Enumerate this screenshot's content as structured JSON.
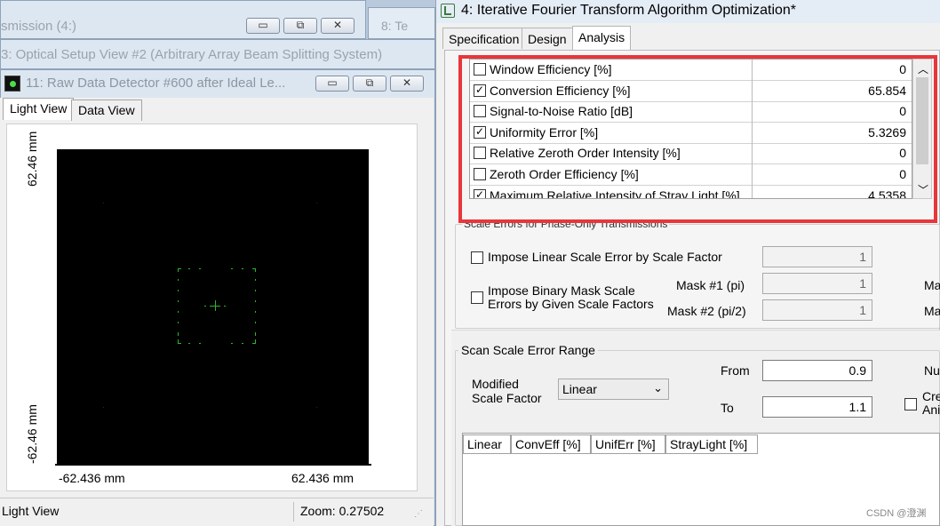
{
  "background_windows": {
    "win1_title": "smission (4:)",
    "win1_tab": "8: Te",
    "win2_title": "3: Optical Setup View #2 (Arbitrary Array Beam Splitting System)"
  },
  "viewer": {
    "title": "11: Raw Data Detector #600 after Ideal Le...",
    "tabs": [
      "Light View",
      "Data View"
    ],
    "y_top_label": "62.46 mm",
    "y_bottom_label": "-62.46 mm",
    "x_left_label": "-62.436 mm",
    "x_right_label": "62.436 mm",
    "status_left": "Light View",
    "status_zoom": "Zoom: 0.27502"
  },
  "window_buttons": {
    "minimize": "▭",
    "restore": "⧉",
    "close": "✕"
  },
  "doc": {
    "title": "4: Iterative Fourier Transform Algorithm Optimization*",
    "tabs": [
      "Specification",
      "Design",
      "Analysis"
    ],
    "active_tab": "Analysis"
  },
  "metrics": [
    {
      "label": "Window Efficiency [%]",
      "checked": false,
      "value": "0"
    },
    {
      "label": "Conversion Efficiency [%]",
      "checked": true,
      "value": "65.854"
    },
    {
      "label": "Signal-to-Noise Ratio [dB]",
      "checked": false,
      "value": "0"
    },
    {
      "label": "Uniformity Error [%]",
      "checked": true,
      "value": "5.3269"
    },
    {
      "label": "Relative Zeroth Order Intensity [%]",
      "checked": false,
      "value": "0"
    },
    {
      "label": "Zeroth Order Efficiency [%]",
      "checked": false,
      "value": "0"
    },
    {
      "label": "Maximum Relative Intensity of Stray Light [%]",
      "checked": true,
      "value": "4.5358"
    }
  ],
  "scale_errors": {
    "group_title": "Scale Errors for Phase-Only Transmissions",
    "impose_linear_label": "Impose Linear Scale Error by Scale Factor",
    "impose_linear_value": "1",
    "impose_binary_label_1": "Impose Binary Mask Scale",
    "impose_binary_label_2": "Errors by Given Scale Factors",
    "mask1_label": "Mask #1 (pi)",
    "mask1_value": "1",
    "mask2_label": "Mask #2 (pi/2)",
    "mask2_value": "1",
    "cut_label_1": "Ma",
    "cut_label_2": "Ma"
  },
  "scan": {
    "group_title": "Scan Scale Error Range",
    "modified_label_1": "Modified",
    "modified_label_2": "Scale Factor",
    "dropdown_value": "Linear",
    "from_label": "From",
    "from_value": "0.9",
    "to_label": "To",
    "to_value": "1.1",
    "cut_nu": "Nu",
    "cut_cre": "Cre",
    "cut_ani": "Ani",
    "columns": [
      "Linear",
      "ConvEff [%]",
      "UnifErr [%]",
      "StrayLight [%]"
    ]
  },
  "watermark": "CSDN @澄渊",
  "colors": {
    "highlight_border": "#e8363a",
    "detector_spots": "#2fbf2f",
    "plot_bg": "#000000"
  }
}
